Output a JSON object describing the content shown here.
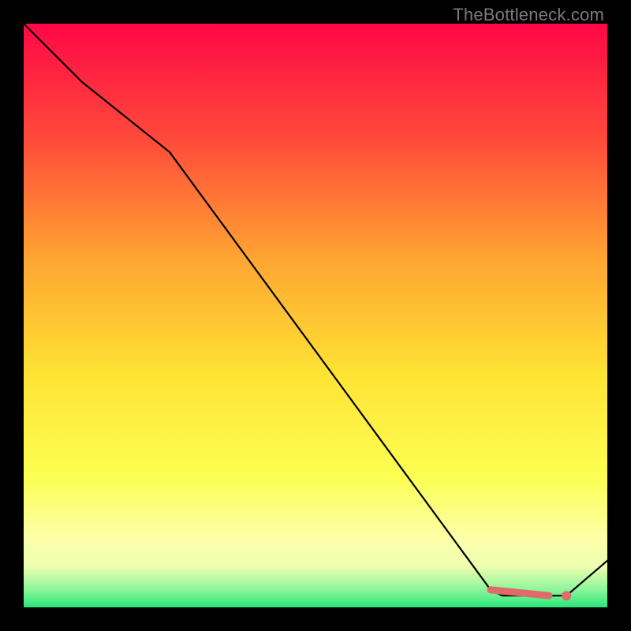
{
  "watermark": "TheBottleneck.com",
  "colors": {
    "stop0": "#ff0746",
    "stop20": "#ff4b3a",
    "stop40": "#ffa432",
    "stop60": "#ffe334",
    "stop78": "#fcff53",
    "stop88": "#fdffa8",
    "stop93": "#eeffb0",
    "stop97": "#8cf59a",
    "stop100": "#27e77b",
    "black": "#000000",
    "marker": "#e06a6a"
  },
  "chart_data": {
    "type": "line",
    "title": "",
    "xlabel": "",
    "ylabel": "",
    "xlim": [
      0,
      100
    ],
    "ylim": [
      0,
      100
    ],
    "series": [
      {
        "name": "curve",
        "x": [
          0,
          10,
          25,
          80,
          82,
          90,
          93,
          100
        ],
        "values": [
          100,
          90,
          78,
          3,
          2,
          2,
          2,
          8
        ]
      }
    ],
    "markers": {
      "name": "highlight-segment",
      "segment": {
        "x1": 80,
        "y1": 3,
        "x2": 90,
        "y2": 2
      },
      "end_dot": {
        "x": 93,
        "y": 2
      }
    }
  }
}
